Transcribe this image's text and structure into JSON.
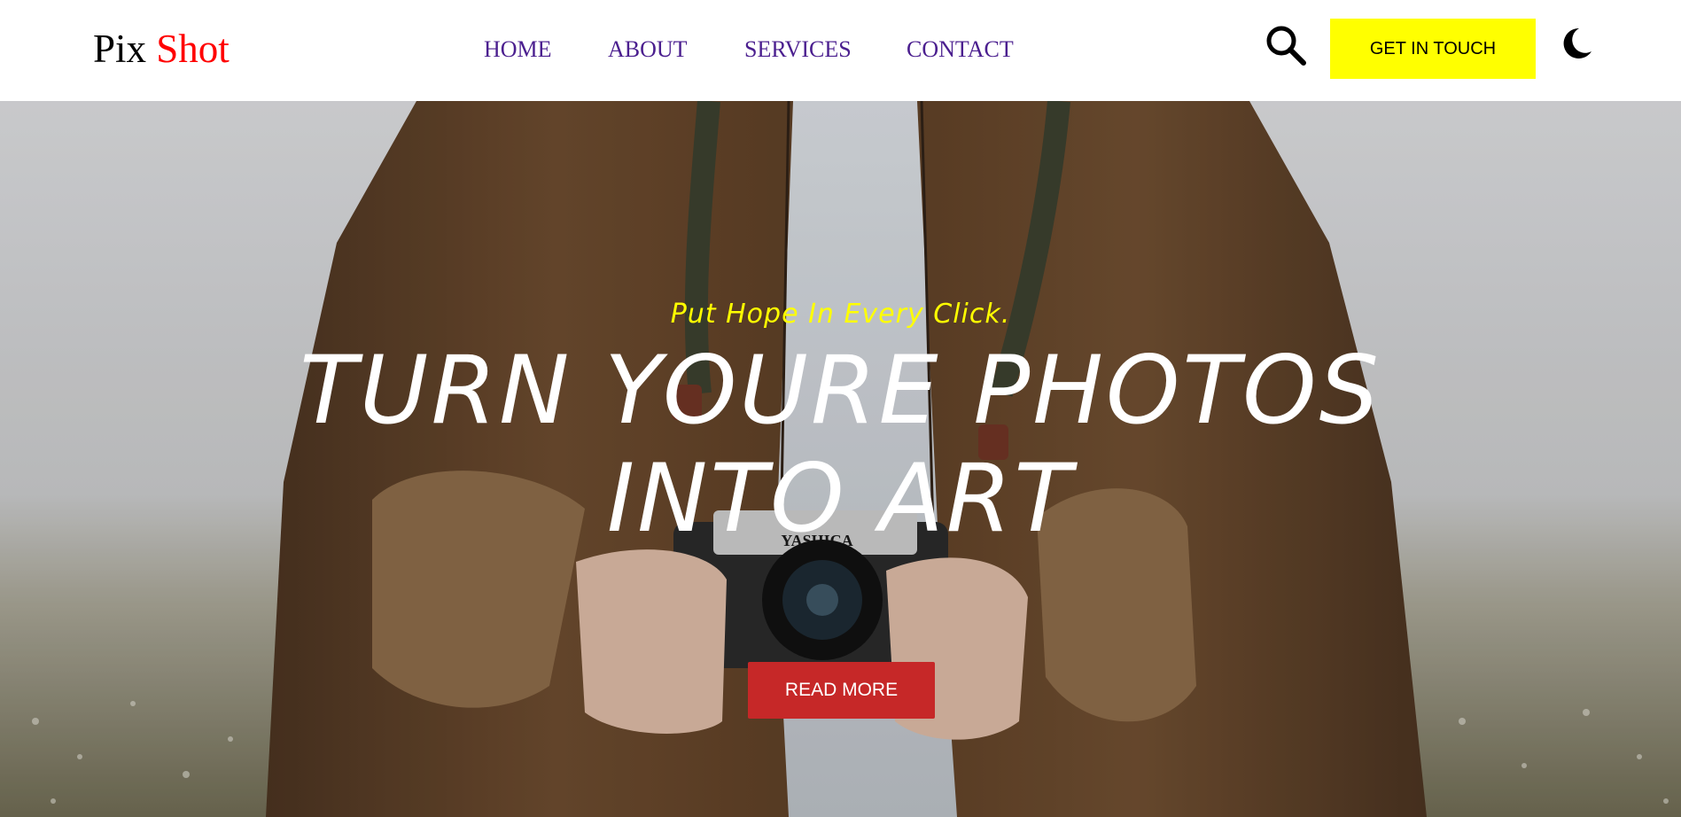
{
  "logo": {
    "part1": "Pix",
    "part2": "Shot"
  },
  "nav": {
    "items": [
      {
        "label": "HOME"
      },
      {
        "label": "ABOUT"
      },
      {
        "label": "SERVICES"
      },
      {
        "label": "CONTACT"
      }
    ]
  },
  "header_actions": {
    "search_icon": "search-icon",
    "cta_label": "GET IN TOUCH",
    "theme_icon": "moon-icon"
  },
  "hero": {
    "tagline": "Put Hope In Every Click.",
    "title": "TURN YOURE PHOTOS INTO ART",
    "button_label": "READ MORE",
    "camera_brand": "YASHICA"
  },
  "colors": {
    "logo_accent": "#ff0000",
    "nav_link": "#4b1f8f",
    "cta_background": "#ffff00",
    "tagline": "#ffff00",
    "hero_title": "#ffffff",
    "read_more_background": "#c62828"
  }
}
